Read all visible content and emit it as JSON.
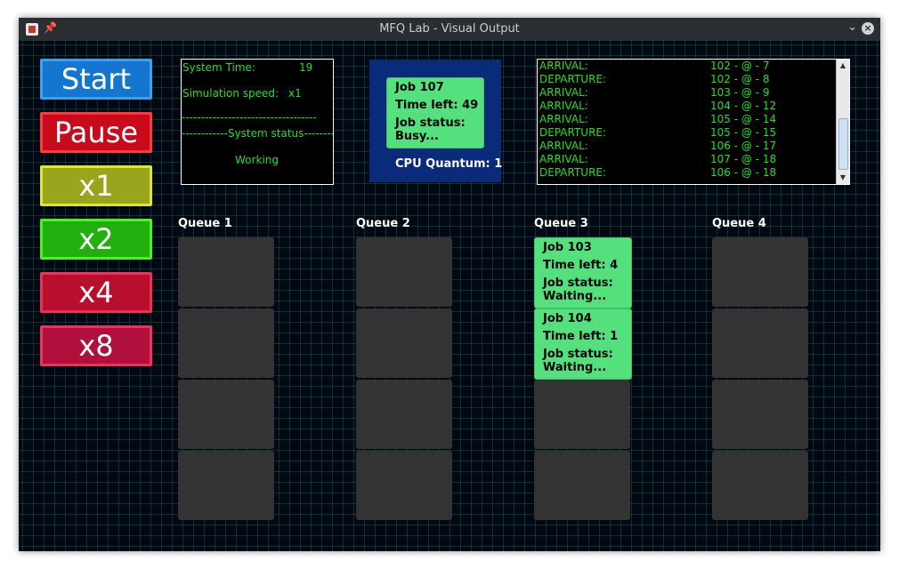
{
  "window": {
    "title": "MFQ Lab - Visual Output"
  },
  "controls": [
    {
      "label": "Start",
      "color": "#1576d0",
      "border": "#3aa0f0",
      "name": "start-button"
    },
    {
      "label": "Pause",
      "color": "#c80a1c",
      "border": "#ff3a3a",
      "name": "pause-button"
    },
    {
      "label": "x1",
      "color": "#9aa51e",
      "border": "#dde82a",
      "name": "speed-x1-button"
    },
    {
      "label": "x2",
      "color": "#22b00f",
      "border": "#4cf028",
      "name": "speed-x2-button"
    },
    {
      "label": "x4",
      "color": "#b8102c",
      "border": "#f0305a",
      "name": "speed-x4-button"
    },
    {
      "label": "x8",
      "color": "#b0103c",
      "border": "#f03060",
      "name": "speed-x8-button"
    }
  ],
  "status": {
    "system_time_label": "System Time:",
    "system_time_value": "19",
    "speed_label": "Simulation speed:",
    "speed_value": "x1",
    "separator": "-----------------------------------",
    "status_header": "------------System status---------",
    "status_value": "Working"
  },
  "cpu": {
    "job_title": "Job 107",
    "time_left": "Time left: 49",
    "status_label": "Job status:",
    "status_value": "Busy...",
    "quantum": "CPU Quantum: 1"
  },
  "log": [
    {
      "event": "ARRIVAL:",
      "value": "102 - @ - 7"
    },
    {
      "event": "DEPARTURE:",
      "value": "102 - @ - 8"
    },
    {
      "event": "ARRIVAL:",
      "value": "103 - @ - 9"
    },
    {
      "event": "ARRIVAL:",
      "value": "104 - @ - 12"
    },
    {
      "event": "ARRIVAL:",
      "value": "105 - @ - 14"
    },
    {
      "event": "DEPARTURE:",
      "value": "105 - @ - 15"
    },
    {
      "event": "ARRIVAL:",
      "value": "106 - @ - 17"
    },
    {
      "event": "ARRIVAL:",
      "value": "107 - @ - 18"
    },
    {
      "event": "DEPARTURE:",
      "value": "106 - @ - 18"
    }
  ],
  "queues": [
    {
      "label": "Queue 1",
      "jobs": []
    },
    {
      "label": "Queue 2",
      "jobs": []
    },
    {
      "label": "Queue 3",
      "jobs": [
        {
          "title": "Job 103",
          "time_left": "Time left: 4",
          "status_label": "Job status:",
          "status_value": "Waiting..."
        },
        {
          "title": "Job 104",
          "time_left": "Time left: 1",
          "status_label": "Job status:",
          "status_value": "Waiting..."
        }
      ]
    },
    {
      "label": "Queue 4",
      "jobs": []
    }
  ],
  "colors": {
    "grid_background": "#000814",
    "terminal_text": "#22e022",
    "job_card": "#55e07e",
    "empty_slot": "#333333",
    "cpu_panel": "#0a2a7a"
  }
}
